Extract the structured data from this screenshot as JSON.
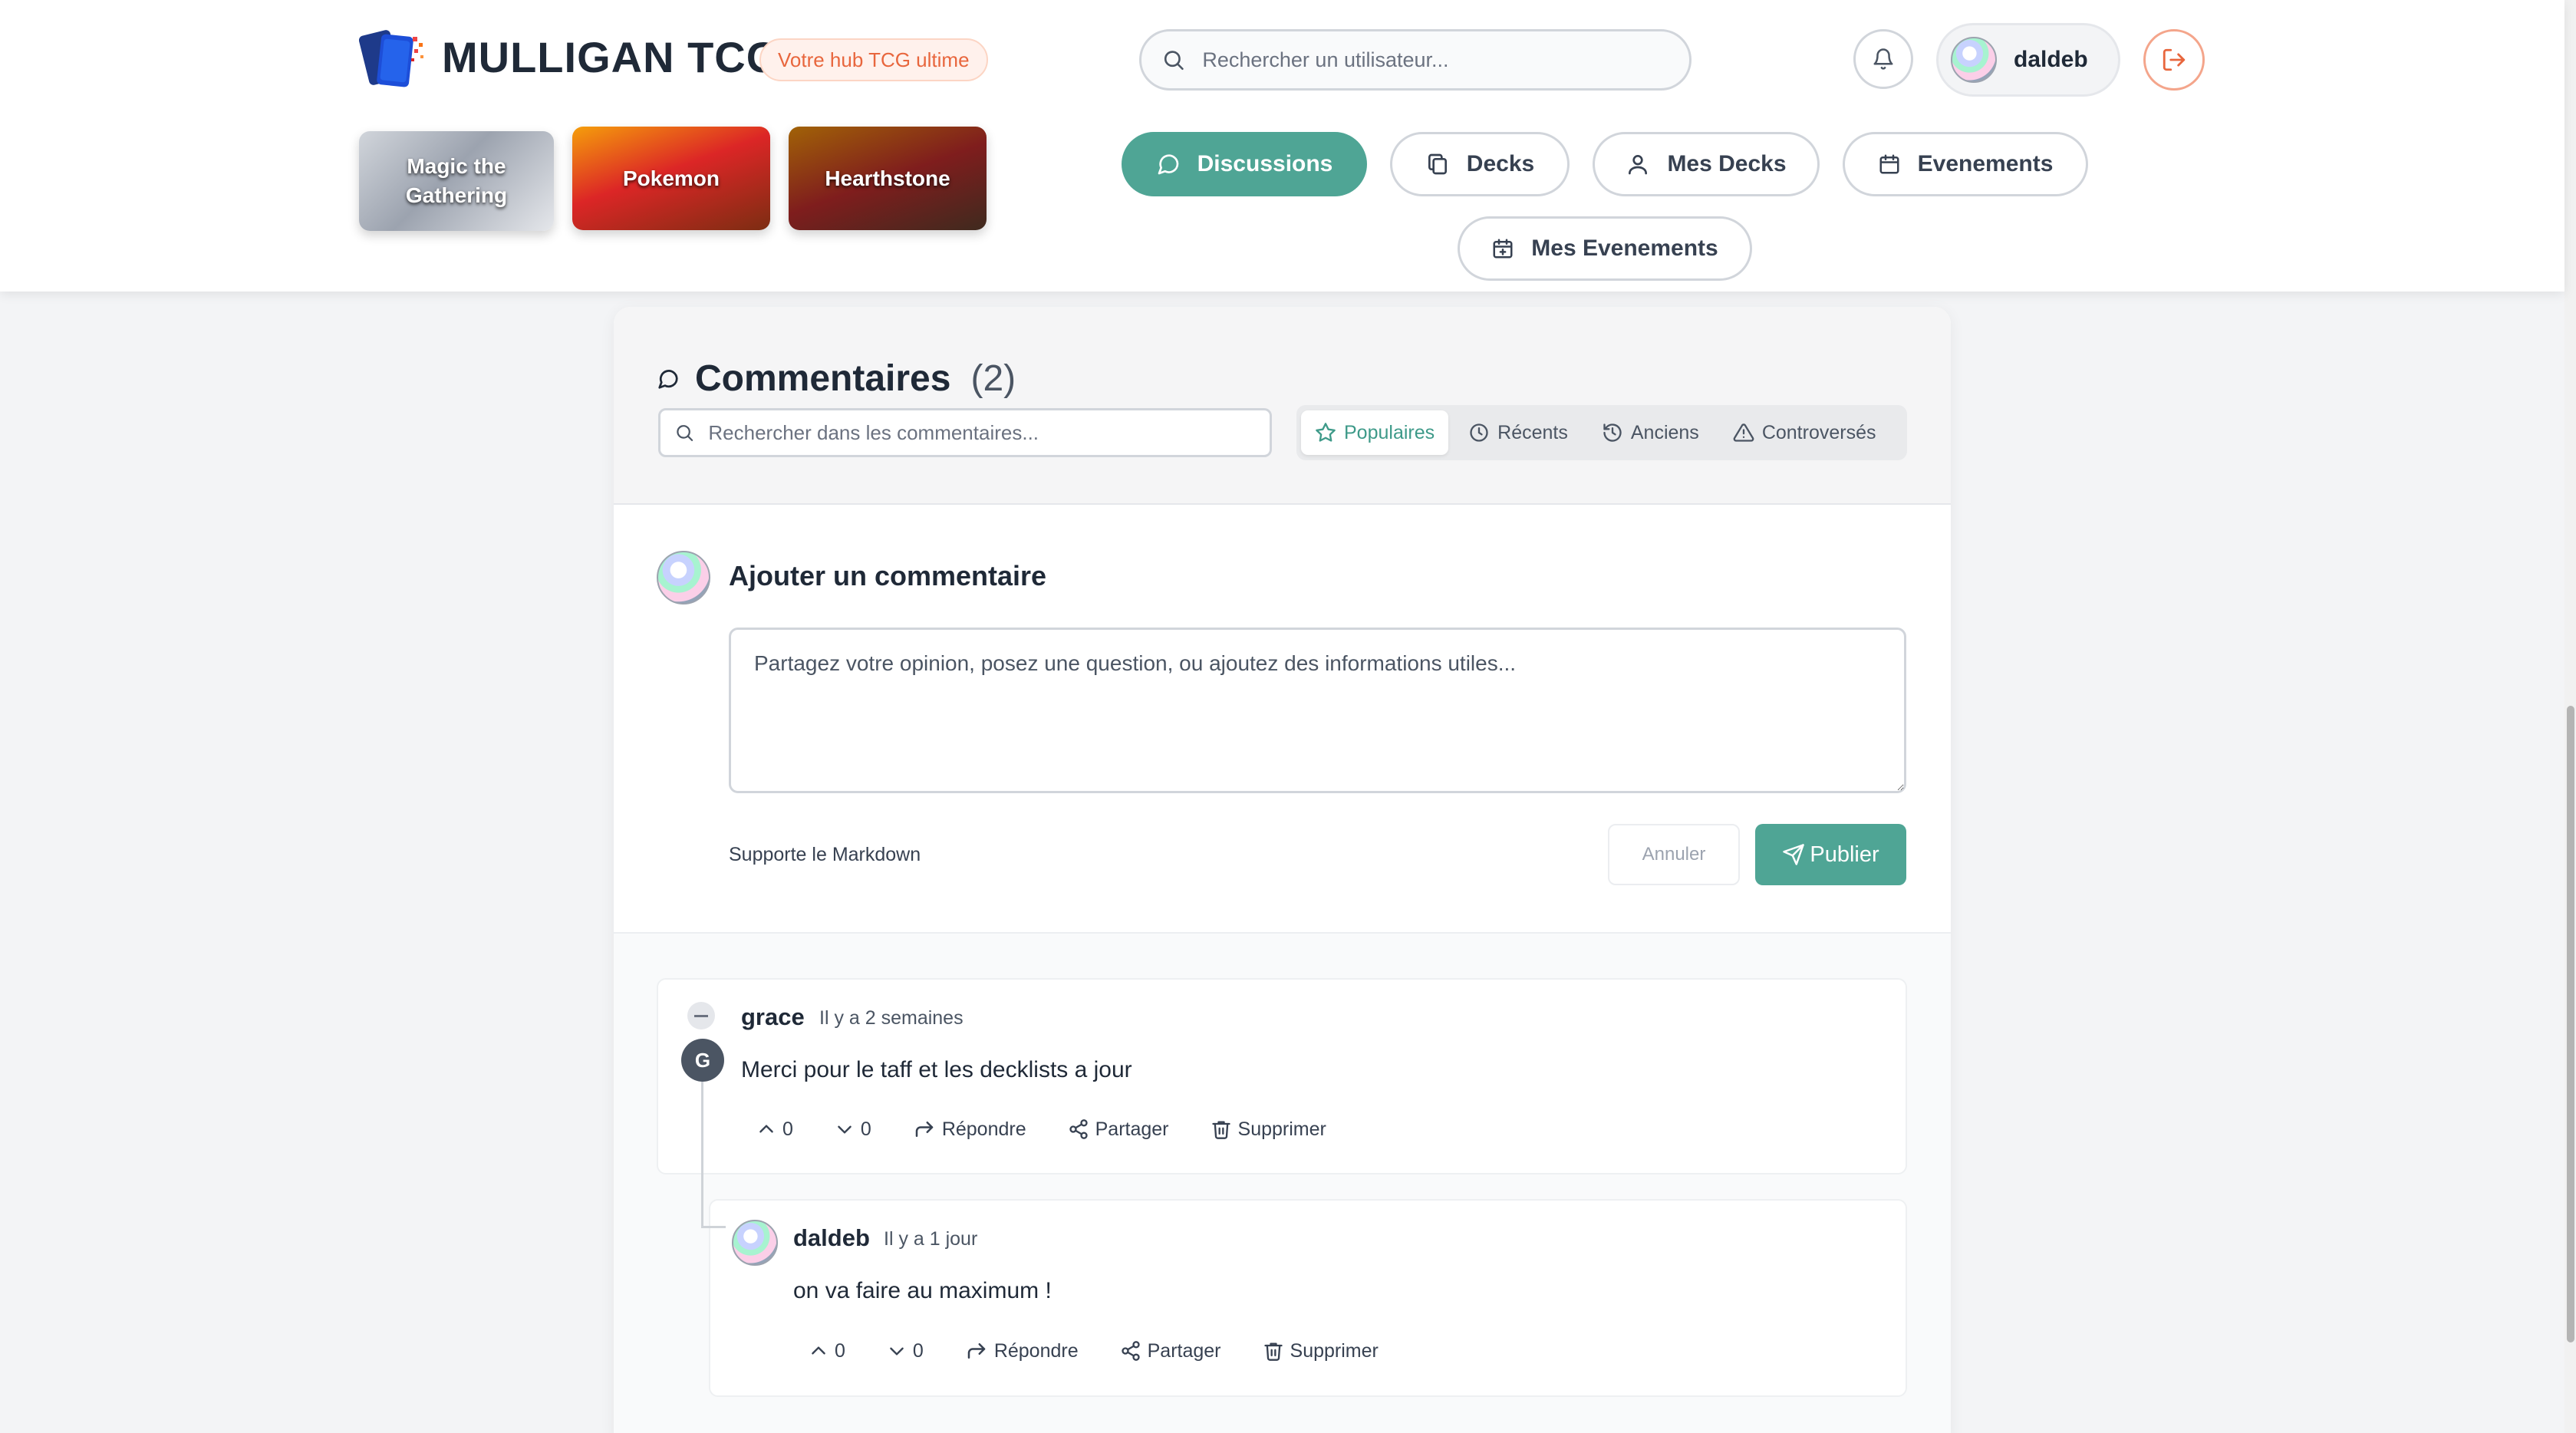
{
  "header": {
    "brand": "MULLIGAN TCG",
    "tagline": "Votre hub TCG ultime",
    "search_placeholder": "Rechercher un utilisateur...",
    "user_name": "daldeb",
    "accent_color": "#4fa595",
    "tagline_color": "#e8663d"
  },
  "games": [
    {
      "label": "Magic the Gathering"
    },
    {
      "label": "Pokemon"
    },
    {
      "label": "Hearthstone"
    }
  ],
  "nav": [
    {
      "label": "Discussions",
      "icon": "chat-icon",
      "active": true
    },
    {
      "label": "Decks",
      "icon": "cards-icon",
      "active": false
    },
    {
      "label": "Mes Decks",
      "icon": "user-icon",
      "active": false
    },
    {
      "label": "Evenements",
      "icon": "calendar-icon",
      "active": false
    },
    {
      "label": "Mes Evenements",
      "icon": "calendar-plus-icon",
      "active": false
    }
  ],
  "comments_section": {
    "title": "Commentaires",
    "count": "(2)",
    "search_placeholder": "Rechercher dans les commentaires...",
    "sort_options": [
      {
        "label": "Populaires",
        "icon": "star-icon",
        "active": true
      },
      {
        "label": "Récents",
        "icon": "clock-icon",
        "active": false
      },
      {
        "label": "Anciens",
        "icon": "history-icon",
        "active": false
      },
      {
        "label": "Controversés",
        "icon": "warning-icon",
        "active": false
      }
    ]
  },
  "add_comment": {
    "title": "Ajouter un commentaire",
    "placeholder": "Partagez votre opinion, posez une question, ou ajoutez des informations utiles...",
    "markdown_note": "Supporte le Markdown",
    "cancel_label": "Annuler",
    "publish_label": "Publier"
  },
  "comments": [
    {
      "author": "grace",
      "avatar_letter": "G",
      "time": "Il y a 2 semaines",
      "body": "Merci pour le taff et les decklists a jour",
      "upvotes": "0",
      "downvotes": "0",
      "reply_label": "Répondre",
      "share_label": "Partager",
      "delete_label": "Supprimer"
    },
    {
      "author": "daldeb",
      "time": "Il y a 1 jour",
      "body": "on va faire au maximum !",
      "upvotes": "0",
      "downvotes": "0",
      "reply_label": "Répondre",
      "share_label": "Partager",
      "delete_label": "Supprimer"
    }
  ]
}
